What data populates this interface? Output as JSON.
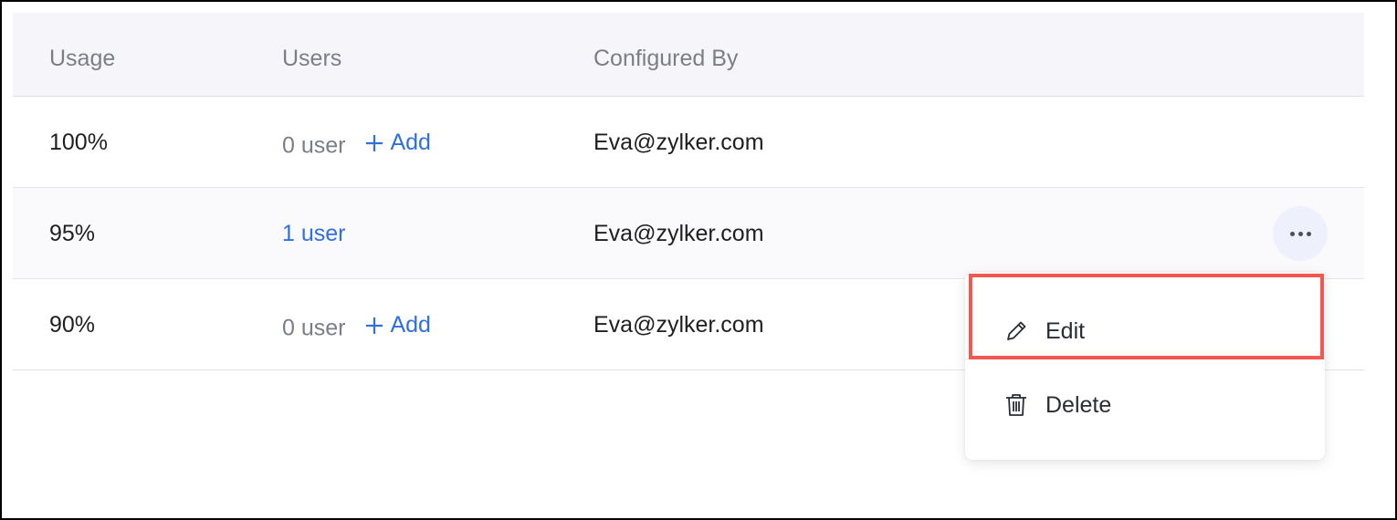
{
  "table": {
    "headers": [
      "Usage",
      "Users",
      "Configured By"
    ],
    "rows": [
      {
        "usage": "100%",
        "users": "0 user",
        "add": "Add",
        "configured_by": "Eva@zylker.com"
      },
      {
        "usage": "95%",
        "users": "1 user",
        "configured_by": "Eva@zylker.com"
      },
      {
        "usage": "90%",
        "users": "0 user",
        "add": "Add",
        "configured_by": "Eva@zylker.com"
      }
    ]
  },
  "menu": {
    "edit_label": "Edit",
    "delete_label": "Delete"
  },
  "icons": {
    "add": "plus-icon",
    "more": "more-horizontal-icon",
    "edit": "pencil-icon",
    "delete": "trash-icon"
  },
  "colors": {
    "link": "#2f6fe4",
    "muted": "#7b7e89",
    "header_bg": "#f6f6fa",
    "highlight": "#f3584f"
  }
}
